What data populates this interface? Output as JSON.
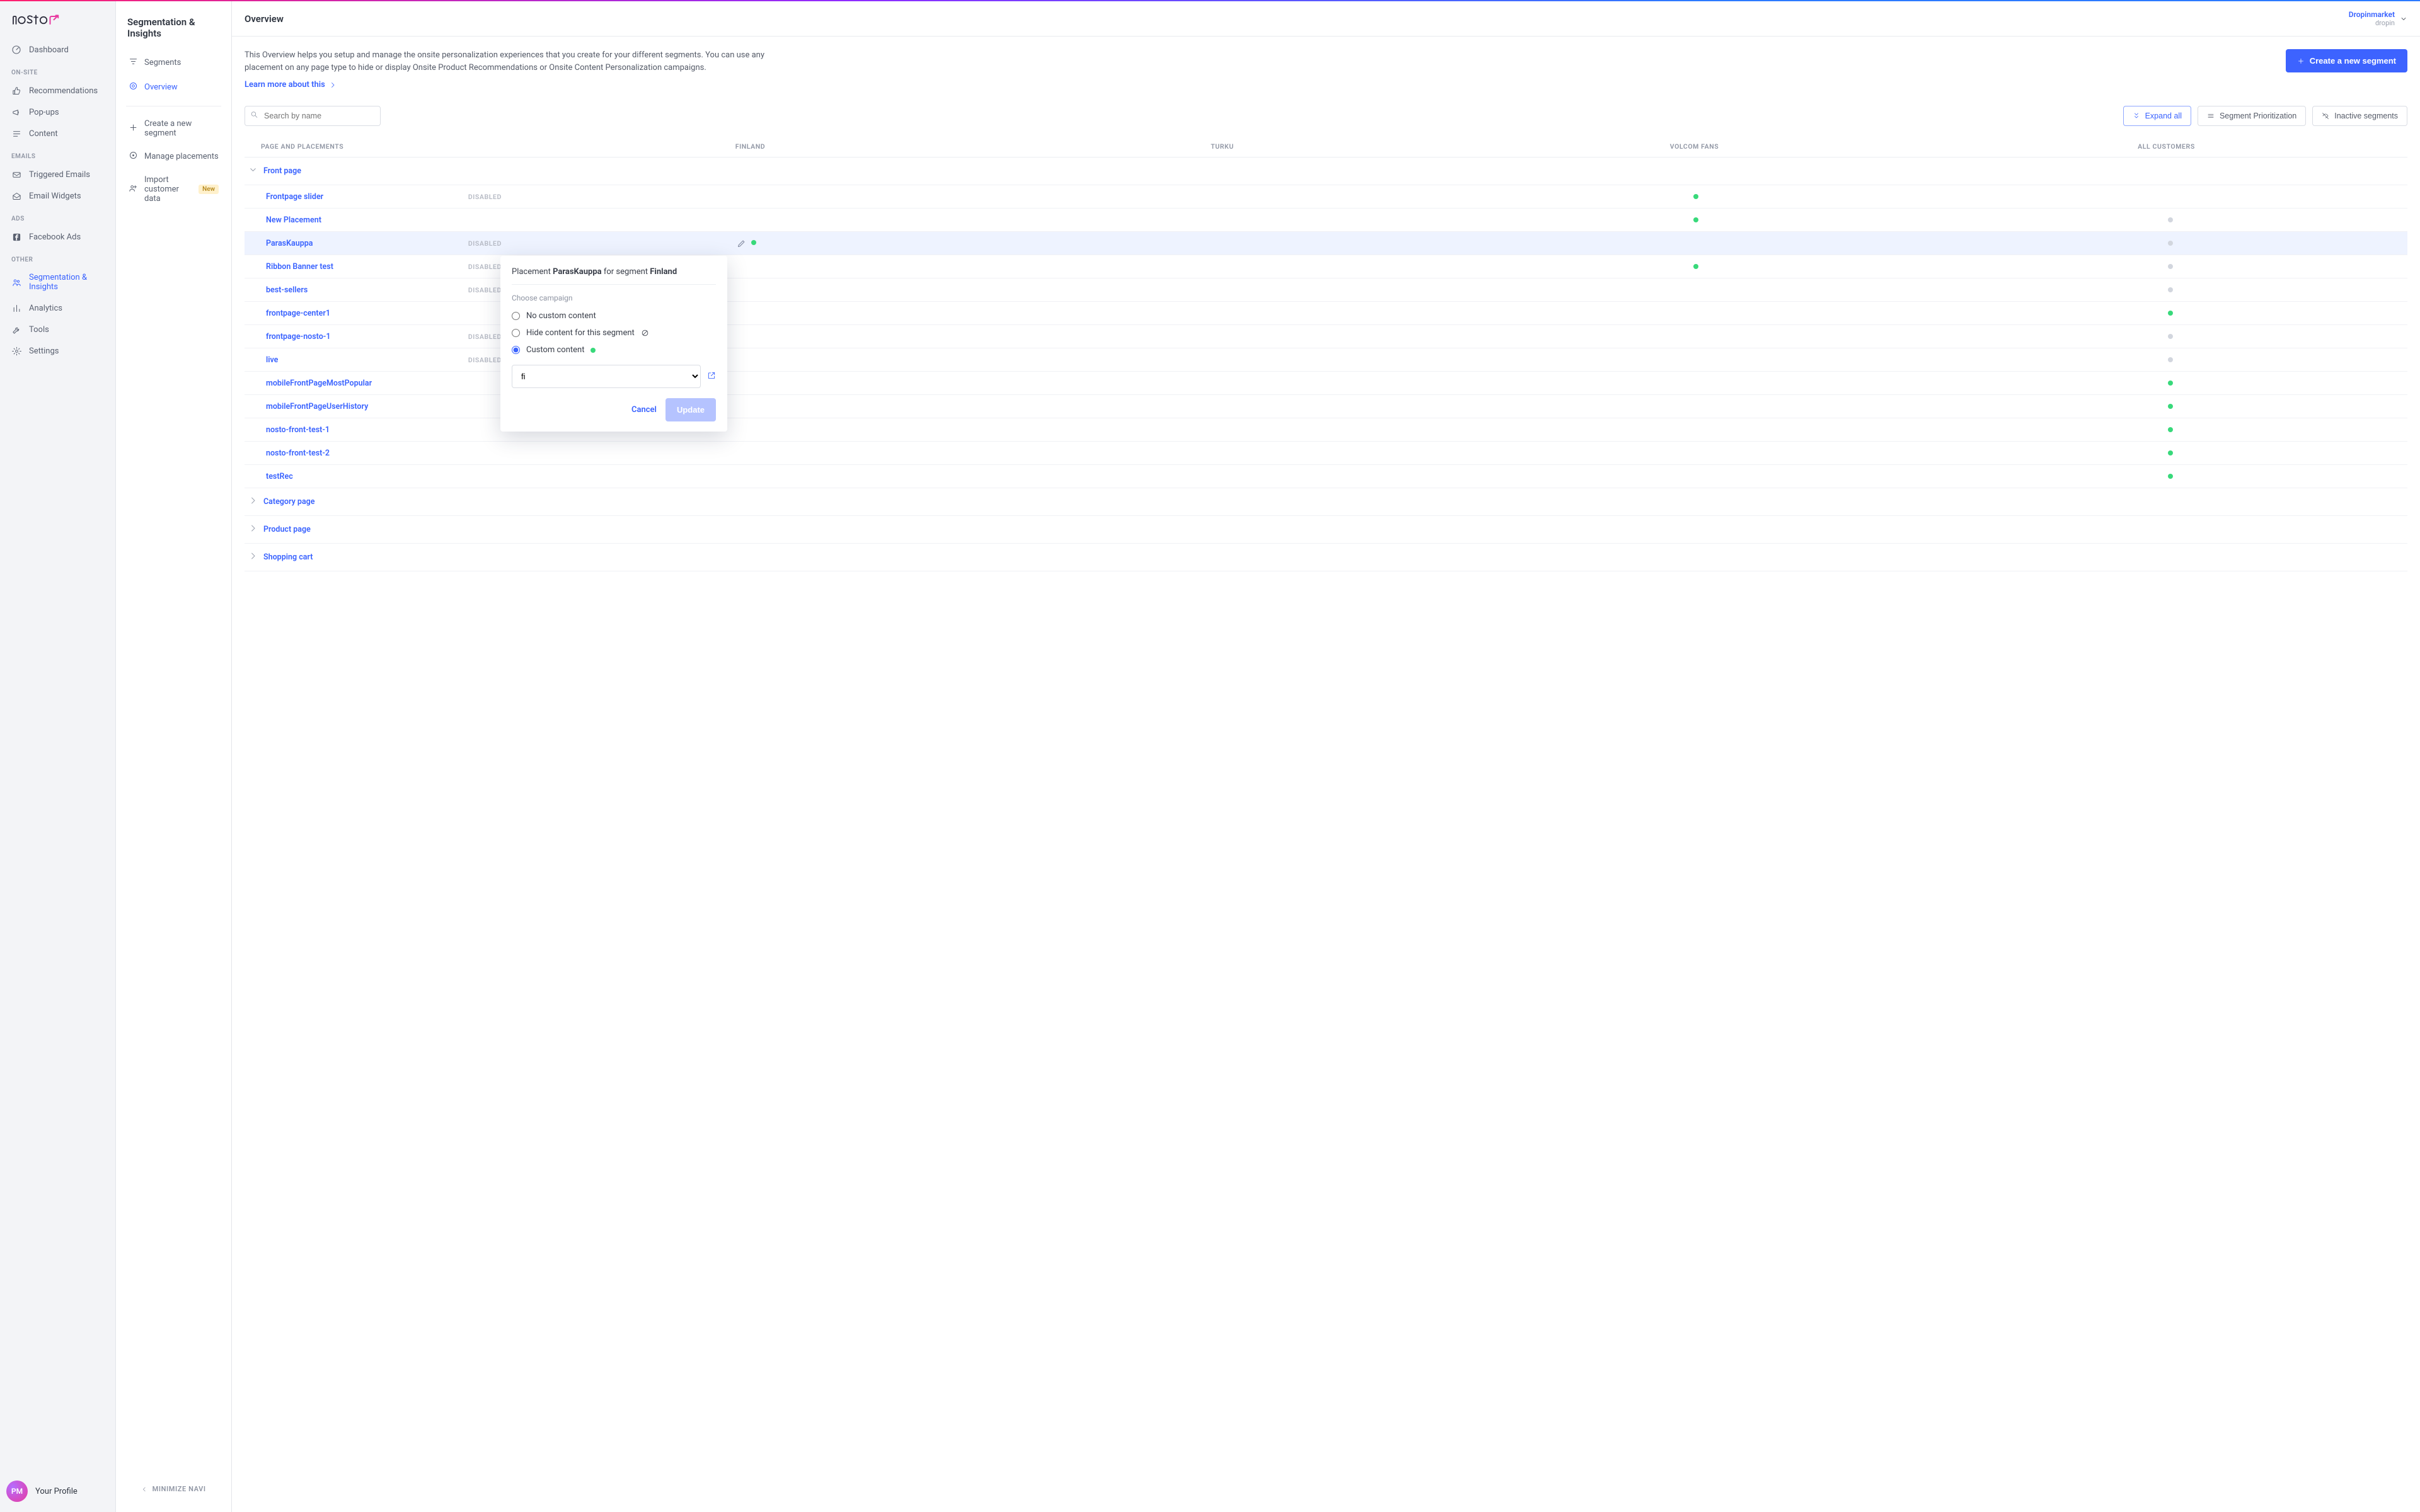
{
  "brand": "nosto",
  "tenant": {
    "name": "Dropinmarket",
    "sub": "dropin"
  },
  "nav1": {
    "dashboard": "Dashboard",
    "groups": [
      {
        "label": "ON-SITE",
        "items": [
          {
            "id": "recommendations",
            "label": "Recommendations",
            "icon": "thumbs-up-icon"
          },
          {
            "id": "popups",
            "label": "Pop-ups",
            "icon": "megaphone-icon"
          },
          {
            "id": "content",
            "label": "Content",
            "icon": "lines-icon"
          }
        ]
      },
      {
        "label": "EMAILS",
        "items": [
          {
            "id": "triggered-emails",
            "label": "Triggered Emails",
            "icon": "mail-icon"
          },
          {
            "id": "email-widgets",
            "label": "Email Widgets",
            "icon": "mail-open-icon"
          }
        ]
      },
      {
        "label": "ADS",
        "items": [
          {
            "id": "facebook-ads",
            "label": "Facebook Ads",
            "icon": "facebook-icon"
          }
        ]
      },
      {
        "label": "OTHER",
        "items": [
          {
            "id": "segmentation",
            "label": "Segmentation & Insights",
            "icon": "people-icon",
            "active": true
          },
          {
            "id": "analytics",
            "label": "Analytics",
            "icon": "bars-icon"
          },
          {
            "id": "tools",
            "label": "Tools",
            "icon": "wrench-icon"
          },
          {
            "id": "settings",
            "label": "Settings",
            "icon": "gear-icon"
          }
        ]
      }
    ],
    "profile": {
      "initials": "PM",
      "label": "Your Profile"
    }
  },
  "nav2": {
    "title": "Segmentation & Insights",
    "items": [
      {
        "id": "segments",
        "label": "Segments",
        "icon": "filters-icon"
      },
      {
        "id": "overview",
        "label": "Overview",
        "icon": "target-icon",
        "active": true
      }
    ],
    "actions": [
      {
        "id": "create-segment",
        "label": "Create a new segment",
        "icon": "plus-icon"
      },
      {
        "id": "manage-placements",
        "label": "Manage placements",
        "icon": "target2-icon"
      },
      {
        "id": "import-data",
        "label": "Import customer data",
        "icon": "people2-icon",
        "badge": "New"
      }
    ],
    "minimize": "MINIMIZE NAVI"
  },
  "main": {
    "title": "Overview",
    "intro": "This Overview helps you setup and manage the onsite personalization experiences that you create for your different segments. You can use any placement on any page type to hide or display Onsite Product Recommendations or Onsite Content Personalization campaigns.",
    "learn": "Learn more about this",
    "create_btn": "Create a new segment",
    "search_placeholder": "Search by name",
    "toolbar": {
      "expand": "Expand all",
      "priority": "Segment Prioritization",
      "inactive": "Inactive segments"
    },
    "columns": [
      "PAGE AND PLACEMENTS",
      "FINLAND",
      "TURKU",
      "VOLCOM FANS",
      "ALL CUSTOMERS"
    ],
    "groups": [
      {
        "name": "Front page",
        "expanded": true,
        "rows": [
          {
            "name": "Frontpage slider",
            "disabled": true,
            "dots": {
              "finland": null,
              "turku": null,
              "volcom": "green",
              "all": null
            }
          },
          {
            "name": "New Placement",
            "disabled": false,
            "dots": {
              "finland": null,
              "turku": null,
              "volcom": "green",
              "all": "grey"
            }
          },
          {
            "name": "ParasKauppa",
            "disabled": true,
            "selected": true,
            "editIcon": true,
            "dots": {
              "finland": "green",
              "turku": null,
              "volcom": null,
              "all": "grey"
            }
          },
          {
            "name": "Ribbon Banner test",
            "disabled": true,
            "dots": {
              "finland": null,
              "turku": null,
              "volcom": "green",
              "all": "grey"
            }
          },
          {
            "name": "best-sellers",
            "disabled": true,
            "dots": {
              "finland": null,
              "turku": null,
              "volcom": null,
              "all": "grey"
            }
          },
          {
            "name": "frontpage-center1",
            "disabled": false,
            "dots": {
              "finland": null,
              "turku": null,
              "volcom": null,
              "all": "green"
            }
          },
          {
            "name": "frontpage-nosto-1",
            "disabled": true,
            "dots": {
              "finland": null,
              "turku": null,
              "volcom": null,
              "all": "grey"
            }
          },
          {
            "name": "live",
            "disabled": true,
            "dots": {
              "finland": null,
              "turku": null,
              "volcom": null,
              "all": "grey"
            }
          },
          {
            "name": "mobileFrontPageMostPopular",
            "disabled": false,
            "dots": {
              "finland": null,
              "turku": null,
              "volcom": null,
              "all": "green"
            }
          },
          {
            "name": "mobileFrontPageUserHistory",
            "disabled": false,
            "dots": {
              "finland": null,
              "turku": null,
              "volcom": null,
              "all": "green"
            }
          },
          {
            "name": "nosto-front-test-1",
            "disabled": false,
            "dots": {
              "finland": null,
              "turku": null,
              "volcom": null,
              "all": "green"
            }
          },
          {
            "name": "nosto-front-test-2",
            "disabled": false,
            "dots": {
              "finland": null,
              "turku": null,
              "volcom": null,
              "all": "green"
            }
          },
          {
            "name": "testRec",
            "disabled": false,
            "dots": {
              "finland": null,
              "turku": null,
              "volcom": null,
              "all": "green"
            }
          }
        ]
      },
      {
        "name": "Category page",
        "expanded": false
      },
      {
        "name": "Product page",
        "expanded": false
      },
      {
        "name": "Shopping cart",
        "expanded": false
      }
    ],
    "popover": {
      "prefix": "Placement ",
      "placement": "ParasKauppa",
      "mid": " for segment ",
      "segment": "Finland",
      "choose": "Choose campaign",
      "opts": {
        "none": "No custom content",
        "hide": "Hide content for this segment",
        "custom": "Custom content"
      },
      "select_value": "fi",
      "cancel": "Cancel",
      "update": "Update"
    }
  }
}
